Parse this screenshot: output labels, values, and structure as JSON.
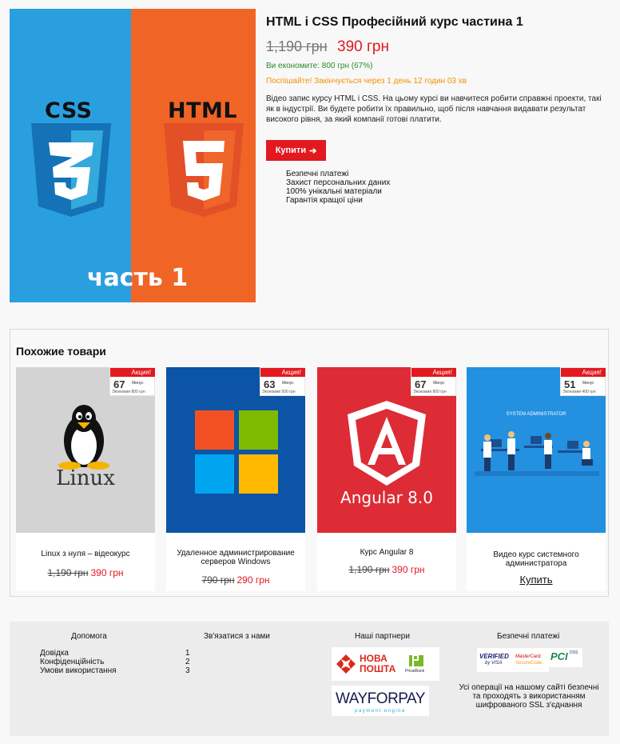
{
  "product": {
    "image_caption": "часть 1",
    "logo_css": "CSS",
    "logo_html": "HTML",
    "title": "HTML і CSS Професійний курс частина 1",
    "old_price": "1,190 грн",
    "new_price": "390 грн",
    "savings": "Ви економите: 800 грн (67%)",
    "hurry": "Поспішайте! Закінчується через 1 день 12 годин 03 хв",
    "description": "Відео запис курсу HTML і CSS. На цьому курсі ви навчитеся робити справжні проекти, такі як в індустрії. Ви будете робити їх правильно, щоб після навчання видавати результат високого рівня, за який компанії готові платити.",
    "buy_label": "Купити",
    "buy_arrow": "➔",
    "features": [
      "Безпечні платежі",
      "Захист персональних даних",
      "100% унікальні матеріали",
      "Гарантія кращої ціни"
    ]
  },
  "related": {
    "title": "Похожие товари",
    "cards": [
      {
        "name": "Linux з нуля – відеокурс",
        "old_price": "1,190 грн",
        "new_price": "390 грн",
        "badge_label": "Акция!",
        "discount": "67",
        "minus": "Минус",
        "economy": "Экономия 800 грн",
        "thumb_text": "Linux",
        "buy": ""
      },
      {
        "name": "Удаленное администрирование серверов Windows",
        "old_price": "790 грн",
        "new_price": "290 грн",
        "badge_label": "Акция!",
        "discount": "63",
        "minus": "Минус",
        "economy": "Экономия 500 грн",
        "thumb_text": "",
        "buy": ""
      },
      {
        "name": "Курс Angular 8",
        "old_price": "1,190 грн",
        "new_price": "390 грн",
        "badge_label": "Акция!",
        "discount": "67",
        "minus": "Минус",
        "economy": "Экономия 800 грн",
        "thumb_text": "Angular 8.0",
        "buy": ""
      },
      {
        "name": "Видео курс системного администратора",
        "old_price": "",
        "new_price": "",
        "badge_label": "Акция!",
        "discount": "51",
        "minus": "Минус",
        "economy": "Экономия 400 грн",
        "thumb_text": "SYSTEM ADMINISTRATOR",
        "buy": "Купить"
      }
    ]
  },
  "footer": {
    "help": {
      "title": "Допомога",
      "items": [
        "Довідка",
        "Конфіденційність",
        "Умови використання"
      ]
    },
    "contact": {
      "title": "Зв'язатися з нами",
      "items": [
        "1",
        "2",
        "3"
      ]
    },
    "partners": {
      "title": "Наші партнери",
      "nova_line1": "НОВА",
      "nova_line2": "ПОШТА",
      "privat": "PrivatBank",
      "wayforpay": "WAYFORPAY",
      "wayforpay_sub": "payment engine"
    },
    "secure": {
      "title": "Безпечні платежі",
      "verified_line1": "VERIFIED",
      "verified_line2": "by VISA",
      "mastercard_line1": "MasterCard.",
      "mastercard_line2": "SecureCode.",
      "pci": "PCI",
      "pci_dss": "DSS",
      "text": "Усі операції на нашому сайті безпечні та проходять з використанням шифрованого SSL з'єднання"
    }
  },
  "colors": {
    "accent": "#e2191f",
    "css_blue": "#2a9fe0",
    "html_orange": "#f06526",
    "savings_green": "#2a8b2a",
    "hurry_orange": "#f39200"
  }
}
